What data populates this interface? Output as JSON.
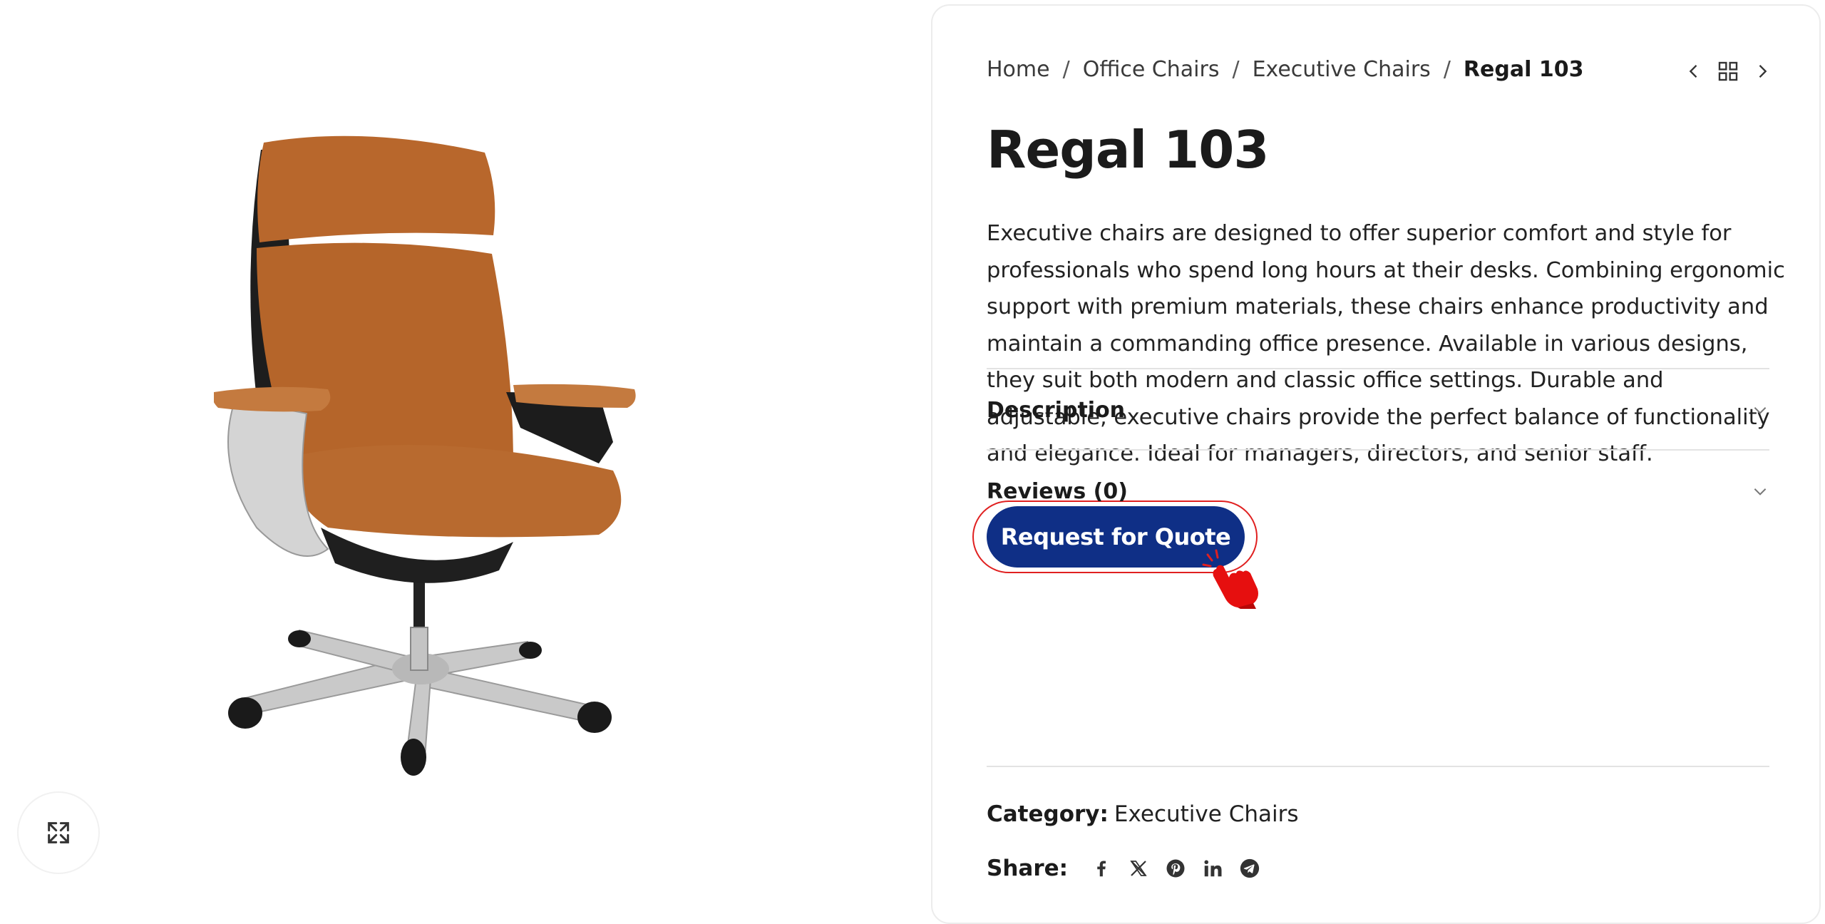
{
  "breadcrumb": {
    "home": "Home",
    "separator": "/",
    "cat1": "Office Chairs",
    "cat2": "Executive Chairs",
    "current": "Regal 103"
  },
  "product": {
    "title": "Regal 103",
    "description": "Executive chairs are designed to offer superior comfort and style for professionals who spend long hours at their desks. Combining ergonomic support with premium materials, these chairs enhance productivity and maintain a commanding office presence. Available in various designs, they suit both modern and classic office settings. Durable and adjustable, executive chairs provide the perfect balance of functionality and elegance. Ideal for managers, directors, and senior staff.",
    "quote_button": "Request for Quote"
  },
  "accordion": [
    {
      "label": "Description"
    },
    {
      "label": "Reviews (0)"
    }
  ],
  "meta": {
    "category_label": "Category:",
    "category_value": "Executive Chairs",
    "share_label": "Share:"
  },
  "icons": {
    "expand": "expand-icon",
    "prev": "chevron-left-icon",
    "grid": "grid-icon",
    "next": "chevron-right-icon",
    "share": [
      "facebook-icon",
      "x-icon",
      "pinterest-icon",
      "linkedin-icon",
      "telegram-icon"
    ]
  },
  "colors": {
    "accent": "#0f2f86",
    "highlight": "#e02020"
  }
}
